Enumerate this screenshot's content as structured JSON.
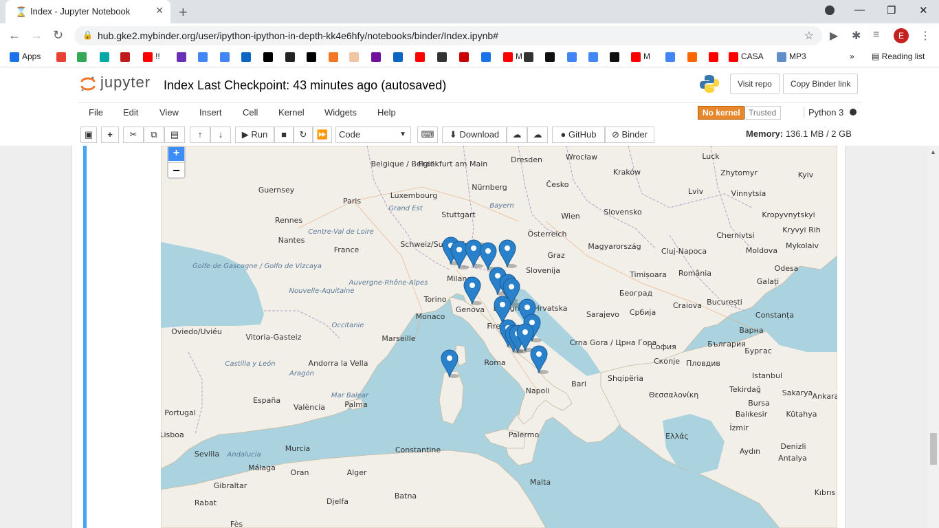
{
  "browser": {
    "tab_title": "Index - Jupyter Notebook",
    "url": "hub.gke2.mybinder.org/user/ipython-ipython-in-depth-kk4e6hfy/notebooks/binder/Index.ipynb#",
    "profile_initial": "E",
    "bookmarks": [
      {
        "label": "Apps",
        "color": "#1a73e8"
      },
      {
        "label": "",
        "color": "#e94235"
      },
      {
        "label": "",
        "color": "#34a853"
      },
      {
        "label": "",
        "color": "#00a8a8"
      },
      {
        "label": "",
        "color": "#c11a1a"
      },
      {
        "label": "!!",
        "color": "#ff0000"
      },
      {
        "label": "",
        "color": "#6b2fb3"
      },
      {
        "label": "",
        "color": "#4285f4"
      },
      {
        "label": "",
        "color": "#4285f4"
      },
      {
        "label": "",
        "color": "#0a66c2"
      },
      {
        "label": "",
        "color": "#000000"
      },
      {
        "label": "",
        "color": "#222222"
      },
      {
        "label": "",
        "color": "#000000"
      },
      {
        "label": "",
        "color": "#f37726"
      },
      {
        "label": "",
        "color": "#f2c6a3"
      },
      {
        "label": "",
        "color": "#720e9e"
      },
      {
        "label": "",
        "color": "#0a66c2"
      },
      {
        "label": "",
        "color": "#ff0000"
      },
      {
        "label": "",
        "color": "#333333"
      },
      {
        "label": "",
        "color": "#cc0000"
      },
      {
        "label": "",
        "color": "#1a73e8"
      },
      {
        "label": "M",
        "color": "#ff0000"
      },
      {
        "label": "",
        "color": "#333333"
      },
      {
        "label": "",
        "color": "#111111"
      },
      {
        "label": "",
        "color": "#4285f4"
      },
      {
        "label": "",
        "color": "#4285f4"
      },
      {
        "label": "",
        "color": "#111111"
      },
      {
        "label": "M",
        "color": "#ff0000"
      },
      {
        "label": "",
        "color": "#4285f4"
      },
      {
        "label": "",
        "color": "#ff6600"
      },
      {
        "label": "",
        "color": "#ff0000"
      },
      {
        "label": "CASA",
        "color": "#ff0000"
      },
      {
        "label": "MP3",
        "color": "#5f8fc8"
      }
    ],
    "more_bookmarks": "»",
    "reading_list": "Reading list"
  },
  "jupyter": {
    "logo_text": "jupyter",
    "notebook_title": "Index Last Checkpoint: 43 minutes ago  (autosaved)",
    "visit_repo": "Visit repo",
    "copy_binder_link": "Copy Binder link",
    "menu": [
      "File",
      "Edit",
      "View",
      "Insert",
      "Cell",
      "Kernel",
      "Widgets",
      "Help"
    ],
    "kernel_status": "No kernel",
    "trusted": "Trusted",
    "kernel_name": "Python 3",
    "toolbar": {
      "run": "Run",
      "cell_type": "Code",
      "download": "Download",
      "github": "GitHub",
      "binder": "Binder"
    },
    "memory_label": "Memory:",
    "memory_value": "136.1 MB / 2 GB"
  },
  "map": {
    "zoom_in": "+",
    "zoom_out": "−",
    "labels": [
      "Belgique / België",
      "Frankfurt am Main",
      "Dresden",
      "Wrocław",
      "Guernsey",
      "Paris",
      "Nürnberg",
      "Česko",
      "Kraków",
      "Luxembourg",
      "Grand Est",
      "Bayern",
      "Stuttgart",
      "Wien",
      "Slovensko",
      "Rennes",
      "Nantes",
      "France",
      "Centre-Val de Loire",
      "Österreich",
      "Magyarország",
      "Schweiz/Suisse/Svizzera",
      "Milano",
      "Graz",
      "Slovenija",
      "Cluj-Napoca",
      "România",
      "Golfe de Gascogne / Golfo de Vizcaya",
      "Auvergne-Rhône-Alpes",
      "Nouvelle-Aquitaine",
      "Torino",
      "Genova",
      "Bologna",
      "Hrvatska",
      "Timișoara",
      "Београд",
      "Craiova",
      "București",
      "Monaco",
      "Occitanie",
      "Sarajevo",
      "Србија",
      "Constanța",
      "Oviedo/Uviéu",
      "Vitoria-Gasteiz",
      "Marseille",
      "Firenze",
      "Варна",
      "Crna Gora / Црна Гора",
      "София",
      "България",
      "Бургас",
      "Castilla y León",
      "Andorra la Vella",
      "Aragón",
      "Roma",
      "Скопје",
      "Пловдив",
      "Shqipëria",
      "Istanbul",
      "España",
      "Napoli",
      "Bari",
      "Θεσσαλονίκη",
      "Tekirdağ",
      "Sakarya",
      "Mar Balear",
      "València",
      "Palma",
      "Bursa",
      "Ankara",
      "Portugal",
      "Balıkesir",
      "Kütahya",
      "Lisboa",
      "Palermo",
      "Ελλάς",
      "İzmir",
      "Murcia",
      "Constantine",
      "Sevilla",
      "Andalucía",
      "Málaga",
      "Oran",
      "Alger",
      "Aydın",
      "Denizli",
      "Antalya",
      "Gibraltar",
      "Malta",
      "Rabat",
      "Batna",
      "Djelfa",
      "Chernivtsi",
      "Luck",
      "Zhytomyr",
      "Kyiv",
      "Lviv",
      "Vinnytsia",
      "Kropyvnytskyi",
      "Kryvyi Rih",
      "Mykolaiv",
      "Moldova",
      "Galați",
      "Odesa",
      "Fès",
      "Kıbrıs"
    ]
  }
}
